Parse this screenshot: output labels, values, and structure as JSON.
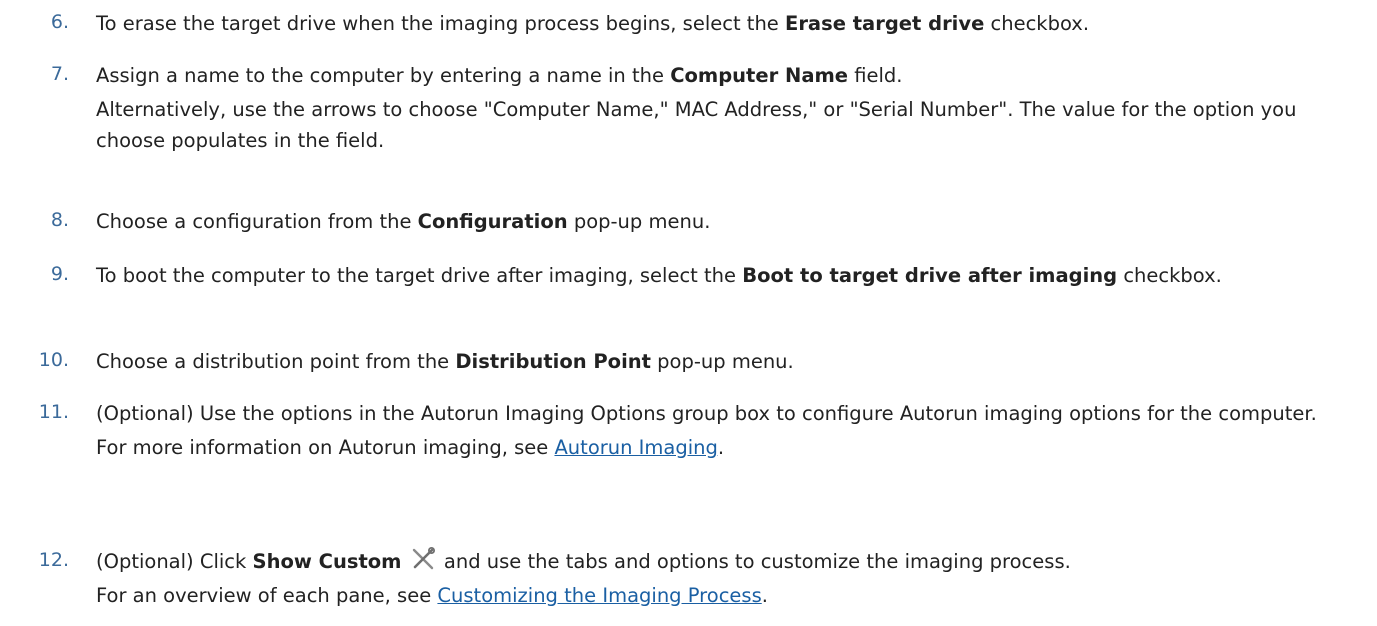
{
  "steps": [
    {
      "number": "6.",
      "line1": {
        "pre": "To erase the target drive when the imaging process begins, select the ",
        "bold": "Erase target drive",
        "post": " checkbox."
      }
    },
    {
      "number": "7.",
      "line1": {
        "pre": "Assign a name to the computer by entering a name in the ",
        "bold": "Computer Name",
        "post": " field."
      },
      "sub": "Alternatively, use the arrows to choose \"Computer Name,\" MAC Address,\" or \"Serial Number\". The value for the option you choose populates in the field."
    },
    {
      "number": "8.",
      "line1": {
        "pre": "Choose a configuration from the ",
        "bold": "Configuration",
        "post": " pop-up menu."
      }
    },
    {
      "number": "9.",
      "line1": {
        "pre": "To boot the computer to the target drive after imaging, select the ",
        "bold": "Boot to target drive after imaging",
        "post": " checkbox."
      }
    },
    {
      "number": "10.",
      "line1": {
        "pre": "Choose a distribution point from the ",
        "bold": "Distribution Point",
        "post": " pop-up menu."
      }
    },
    {
      "number": "11.",
      "line1": {
        "text": "(Optional) Use the options in the Autorun Imaging Options group box to configure Autorun imaging options for the computer."
      },
      "sub": {
        "pre": "For more information on Autorun imaging, see ",
        "link": "Autorun Imaging",
        "post": "."
      }
    },
    {
      "number": "12.",
      "line1": {
        "pre": "(Optional) Click ",
        "bold": "Show Custom",
        "post": " and use the tabs and options to customize the imaging process."
      },
      "icon": "tools-icon",
      "sub": {
        "pre": "For an overview of each pane, see ",
        "link": "Customizing the Imaging Process",
        "post": "."
      }
    }
  ],
  "colors": {
    "number": "#3b6a9a",
    "text": "#222222",
    "link": "#1a5fa3"
  }
}
